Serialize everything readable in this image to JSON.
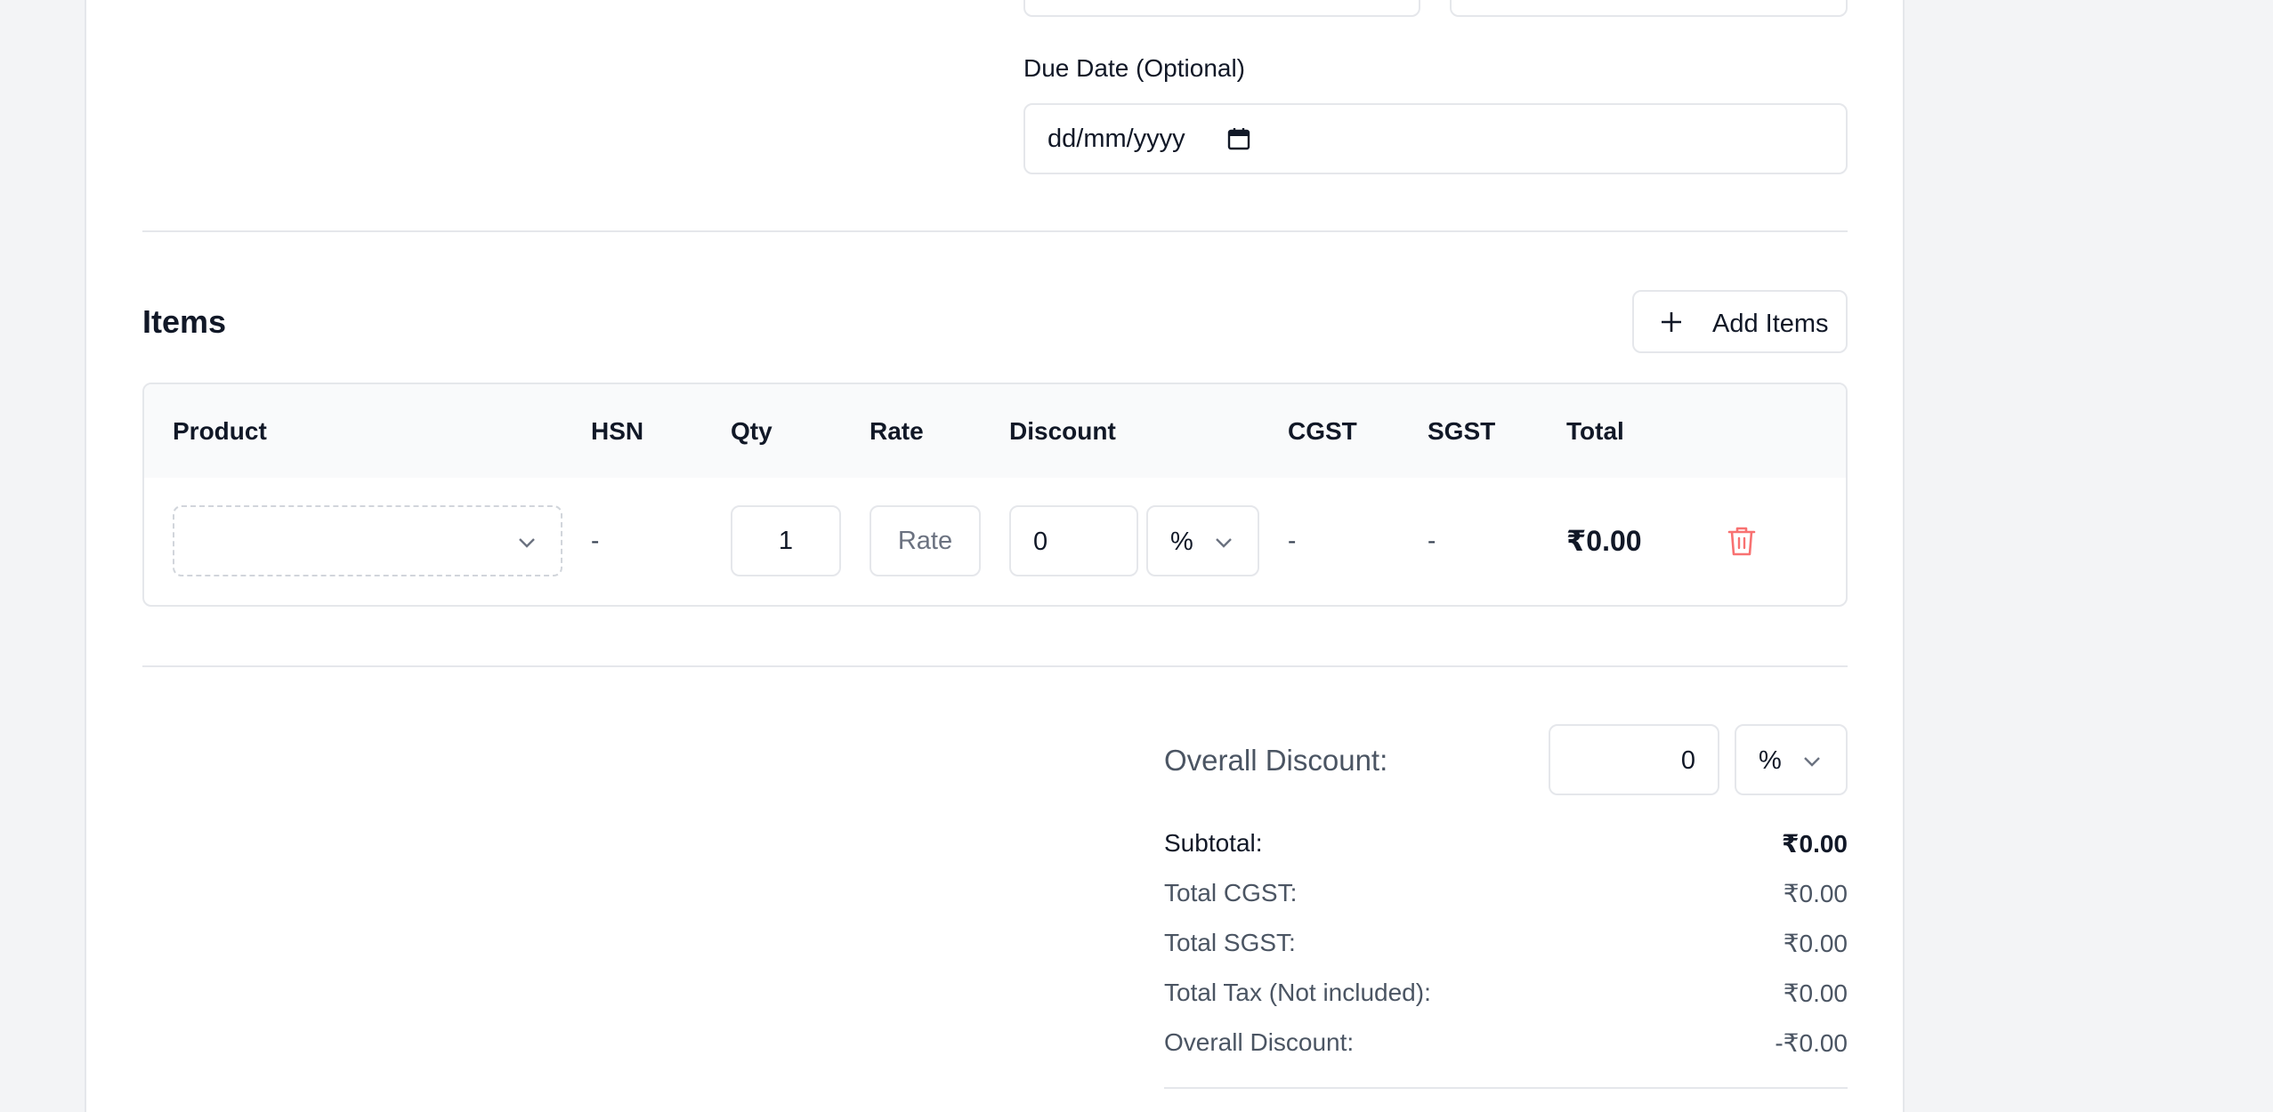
{
  "due_date": {
    "label": "Due Date (Optional)",
    "placeholder": "dd/mm/yyyy"
  },
  "items": {
    "heading": "Items",
    "add_button_label": "Add Items",
    "columns": [
      "Product",
      "HSN",
      "Qty",
      "Rate",
      "Discount",
      "CGST",
      "SGST",
      "Total"
    ],
    "row": {
      "product": "",
      "hsn": "-",
      "qty": "1",
      "rate_placeholder": "Rate",
      "discount": "0",
      "discount_type": "%",
      "cgst": "-",
      "sgst": "-",
      "total": "₹0.00"
    }
  },
  "summary": {
    "overall_discount_label": "Overall Discount:",
    "overall_discount_value": "0",
    "overall_discount_type": "%",
    "rows": [
      {
        "label": "Subtotal:",
        "value": "₹0.00"
      },
      {
        "label": "Total CGST:",
        "value": "₹0.00"
      },
      {
        "label": "Total SGST:",
        "value": "₹0.00"
      },
      {
        "label": "Total Tax (Not included):",
        "value": "₹0.00"
      },
      {
        "label": "Overall Discount:",
        "value": "-₹0.00"
      }
    ]
  },
  "colors": {
    "accent_delete": "#f87171",
    "border": "#e5e7eb",
    "muted_text": "#4b5563"
  }
}
